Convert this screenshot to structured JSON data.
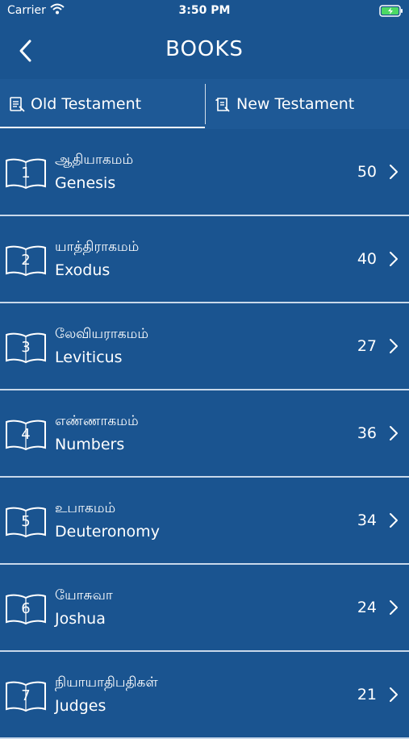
{
  "status_bar": {
    "carrier": "Carrier",
    "time": "3:50 PM"
  },
  "nav": {
    "title": "BOOKS",
    "back_icon": "chevron-left-icon"
  },
  "tabs": [
    {
      "label": "Old Testament",
      "icon": "old-testament-icon",
      "selected": true
    },
    {
      "label": "New Testament",
      "icon": "new-testament-icon",
      "selected": false
    }
  ],
  "books": [
    {
      "number": "1",
      "tamil": "ஆதியாகமம்",
      "english": "Genesis",
      "chapters": "50"
    },
    {
      "number": "2",
      "tamil": "யாத்திராகமம்",
      "english": "Exodus",
      "chapters": "40"
    },
    {
      "number": "3",
      "tamil": "லேவியராகமம்",
      "english": "Leviticus",
      "chapters": "27"
    },
    {
      "number": "4",
      "tamil": "எண்ணாகமம்",
      "english": "Numbers",
      "chapters": "36"
    },
    {
      "number": "5",
      "tamil": "உபாகமம்",
      "english": "Deuteronomy",
      "chapters": "34"
    },
    {
      "number": "6",
      "tamil": "யோசுவா",
      "english": "Joshua",
      "chapters": "24"
    },
    {
      "number": "7",
      "tamil": "நியாயாதிபதிகள்",
      "english": "Judges",
      "chapters": "21"
    }
  ],
  "colors": {
    "background": "#1a5490",
    "divider": "#c8d8ea",
    "text": "#ffffff"
  }
}
